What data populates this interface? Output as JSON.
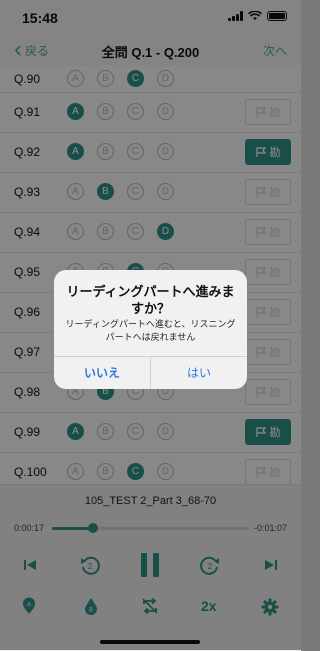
{
  "status": {
    "time": "15:48"
  },
  "nav": {
    "back": "戻る",
    "title": "全問 Q.1 - Q.200",
    "next": "次へ"
  },
  "options": [
    "A",
    "B",
    "C",
    "D"
  ],
  "rows": [
    {
      "q": "Q.90",
      "selected": "C",
      "flagged": false,
      "show_flag": false
    },
    {
      "q": "Q.91",
      "selected": "A",
      "flagged": false,
      "show_flag": true
    },
    {
      "q": "Q.92",
      "selected": "A",
      "flagged": true,
      "show_flag": true
    },
    {
      "q": "Q.93",
      "selected": "B",
      "flagged": false,
      "show_flag": true
    },
    {
      "q": "Q.94",
      "selected": "D",
      "flagged": false,
      "show_flag": true
    },
    {
      "q": "Q.95",
      "selected": "C",
      "flagged": false,
      "show_flag": true
    },
    {
      "q": "Q.96",
      "selected": "",
      "flagged": false,
      "show_flag": true
    },
    {
      "q": "Q.97",
      "selected": "",
      "flagged": false,
      "show_flag": true
    },
    {
      "q": "Q.98",
      "selected": "B",
      "flagged": false,
      "show_flag": true
    },
    {
      "q": "Q.99",
      "selected": "A",
      "flagged": true,
      "show_flag": true
    },
    {
      "q": "Q.100",
      "selected": "C",
      "flagged": false,
      "show_flag": true
    }
  ],
  "flag_label": "勘",
  "player": {
    "track": "105_TEST 2_Part 3_68-70",
    "elapsed": "0:00:17",
    "remaining": "-0:01:07",
    "progress": 0.21,
    "speed": "2x",
    "skip_back_seconds": "2",
    "skip_forward_seconds": "2",
    "icon_a_label": "A",
    "icon_b_label": "B"
  },
  "alert": {
    "title": "リーディングパートへ進みますか？",
    "message": "リーディングパートへ進むと、リスニングパートへは戻れません",
    "no": "いいえ",
    "yes": "はい"
  },
  "colors": {
    "accent": "#2f8f86",
    "ios_blue": "#2d7be5"
  }
}
